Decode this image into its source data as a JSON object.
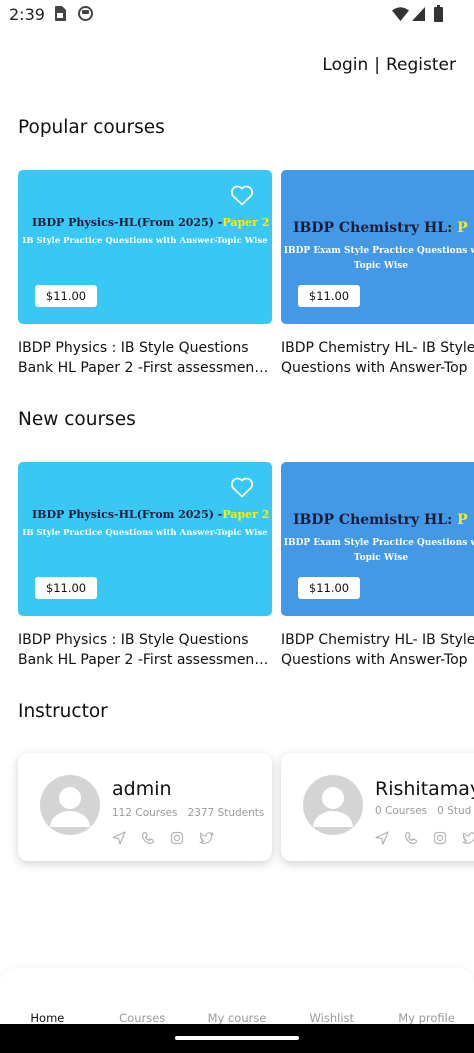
{
  "status_bar": {
    "time": "2:39"
  },
  "header": {
    "login_label": "Login",
    "separator": "|",
    "register_label": "Register"
  },
  "popular": {
    "title": "Popular courses",
    "courses": [
      {
        "banner_line1": "IBDP Physics-HL(From 2025) -",
        "banner_highlight": "Paper 2",
        "banner_line2": "IB Style Practice Questions with Answer-Topic Wise",
        "price": "$11.00",
        "title_line1": "IBDP Physics : IB Style Questions",
        "title_line2": "Bank HL Paper 2 -First assessment…"
      },
      {
        "banner_line1": "IBDP Chemistry HL:",
        "banner_highlight": "P",
        "banner_line2": "IBDP Exam Style Practice Questions w Topic Wise",
        "price": "$11.00",
        "title_line1": "IBDP Chemistry HL- IB Style",
        "title_line2": "Questions with Answer-Top"
      }
    ]
  },
  "new": {
    "title": "New courses",
    "courses": [
      {
        "banner_line1": "IBDP Physics-HL(From 2025) -",
        "banner_highlight": "Paper 2",
        "banner_line2": "IB Style Practice Questions with Answer-Topic Wise",
        "price": "$11.00",
        "title_line1": "IBDP Physics : IB Style Questions",
        "title_line2": "Bank HL Paper 2 -First assessment…"
      },
      {
        "banner_line1": "IBDP Chemistry HL:",
        "banner_highlight": "P",
        "banner_line2": "IBDP Exam Style Practice Questions w Topic Wise",
        "price": "$11.00",
        "title_line1": "IBDP Chemistry HL- IB Style",
        "title_line2": "Questions with Answer-Top"
      }
    ]
  },
  "instructor": {
    "title": "Instructor",
    "items": [
      {
        "name": "admin",
        "courses": "112 Courses",
        "students": "2377 Students"
      },
      {
        "name": "Rishitamay",
        "courses": "0 Courses",
        "students": "0 Stud"
      }
    ]
  },
  "bottom_nav": {
    "items": [
      {
        "label": "Home"
      },
      {
        "label": "Courses"
      },
      {
        "label": "My course"
      },
      {
        "label": "Wishlist"
      },
      {
        "label": "My profile"
      }
    ]
  },
  "colors": {
    "physics_banner": "#38c8f3",
    "chemistry_banner": "#4499e6",
    "highlight": "#f7f200"
  },
  "icons": [
    "sim-card-icon",
    "app-notification-icon",
    "wifi-icon",
    "signal-icon",
    "battery-icon",
    "heart-icon",
    "send-icon",
    "phone-icon",
    "instagram-icon",
    "twitter-icon",
    "avatar-placeholder-icon"
  ]
}
